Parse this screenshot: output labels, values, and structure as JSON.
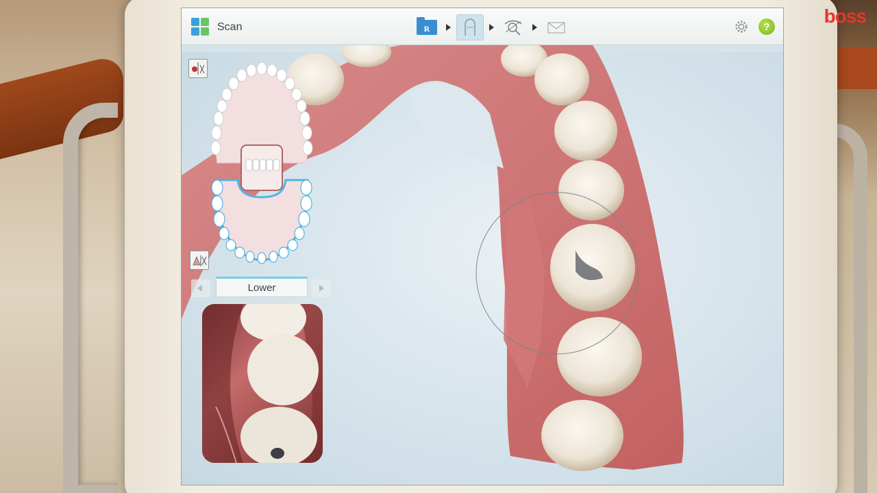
{
  "header": {
    "title": "Scan",
    "workflow_steps": [
      {
        "name": "rx",
        "label": "R",
        "active": false
      },
      {
        "name": "scan",
        "active": true
      },
      {
        "name": "view",
        "active": false
      },
      {
        "name": "send",
        "active": false
      }
    ]
  },
  "arch": {
    "current": "Lower"
  },
  "brand": {
    "text": "boss",
    "color": "#e8352c"
  },
  "colors": {
    "accent": "#3aa0d8",
    "help": "#7cb324",
    "gum": "#cf6e6e",
    "tooth": "#f1ece2",
    "selection": "#4fb4e0"
  },
  "icons": [
    "app-grid-icon",
    "rx-folder-icon",
    "tooth-scan-icon",
    "view-tools-icon",
    "send-envelope-icon",
    "gear-icon",
    "help-icon",
    "jaw-view-toggle-icon",
    "jaw-view-alt-icon"
  ]
}
